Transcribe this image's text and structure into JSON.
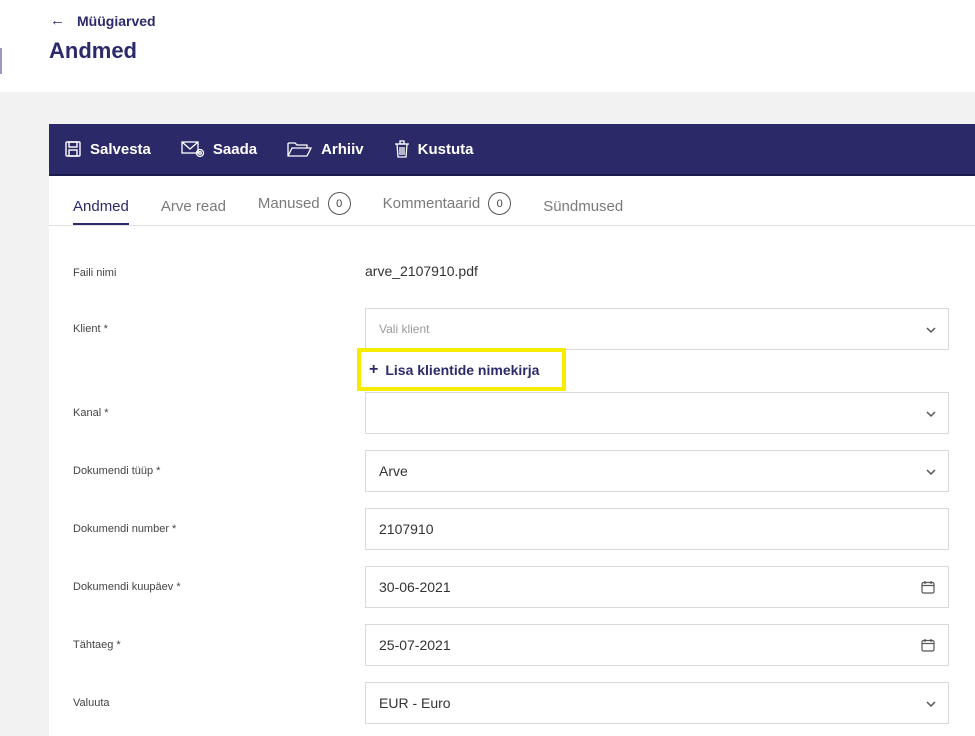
{
  "header": {
    "back_label": "Müügiarved",
    "page_title": "Andmed"
  },
  "toolbar": {
    "save": "Salvesta",
    "send": "Saada",
    "archive": "Arhiiv",
    "delete": "Kustuta"
  },
  "tabs": {
    "details": "Andmed",
    "invoice_rows": "Arve read",
    "attachments": "Manused",
    "attachments_count": "0",
    "comments": "Kommentaarid",
    "comments_count": "0",
    "events": "Sündmused"
  },
  "form": {
    "file_name_label": "Faili nimi",
    "file_name_value": "arve_2107910.pdf",
    "client_label": "Klient *",
    "client_placeholder": "Vali klient",
    "add_client_label": "Lisa klientide nimekirja",
    "channel_label": "Kanal *",
    "channel_value": "",
    "doc_type_label": "Dokumendi tüüp *",
    "doc_type_value": "Arve",
    "doc_number_label": "Dokumendi number *",
    "doc_number_value": "2107910",
    "doc_date_label": "Dokumendi kuupäev *",
    "doc_date_value": "30-06-2021",
    "due_date_label": "Tähtaeg *",
    "due_date_value": "25-07-2021",
    "currency_label": "Valuuta",
    "currency_value": "EUR - Euro"
  },
  "colors": {
    "brand": "#2b2968",
    "highlight": "#f5ec00",
    "background": "#f2f2f2"
  }
}
